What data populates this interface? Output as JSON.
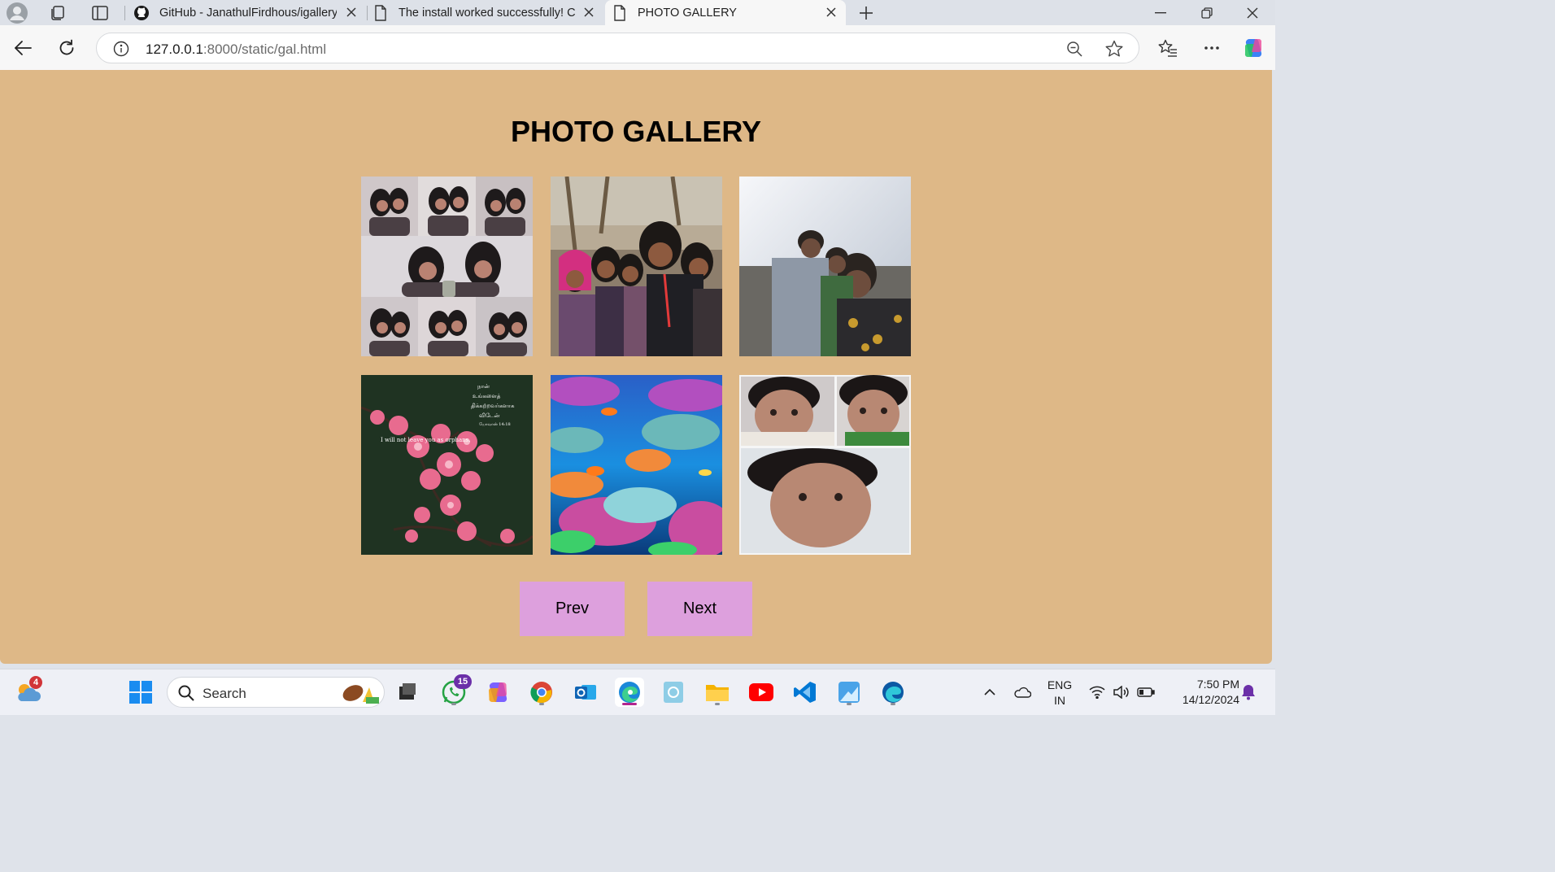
{
  "browser": {
    "tabs": [
      {
        "title": "GitHub - JanathulFirdhous/igallery",
        "icon": "github-icon",
        "active": false
      },
      {
        "title": "The install worked successfully! Congratulations!",
        "icon": "page-icon",
        "active": false
      },
      {
        "title": "PHOTO GALLERY",
        "icon": "page-icon",
        "active": true
      }
    ],
    "address": {
      "host": "127.0.0.1",
      "path": ":8000/static/gal.html"
    }
  },
  "page": {
    "heading": "PHOTO GALLERY",
    "background_color": "#deb887",
    "photos": [
      {
        "subject": "selfie-collage",
        "caption": ""
      },
      {
        "subject": "group-selfie-outdoors",
        "caption": ""
      },
      {
        "subject": "family-selfie-beach",
        "caption": ""
      },
      {
        "subject": "cherry-blossom-verse",
        "caption": "I will not leave you as orphans."
      },
      {
        "subject": "coral-reef",
        "caption": ""
      },
      {
        "subject": "baby-collage",
        "caption": ""
      }
    ],
    "buttons": {
      "prev": "Prev",
      "next": "Next"
    },
    "button_color": "#dda0dd"
  },
  "taskbar": {
    "search_label": "Search",
    "weather_badge": "4",
    "whatsapp_badge": "15",
    "apps": [
      "start-icon",
      "file-explorer-taskview-icon",
      "whatsapp-icon",
      "copilot-icon",
      "chrome-icon",
      "outlook-icon",
      "edge-icon",
      "photos-icon",
      "folder-icon",
      "youtube-icon",
      "vscode-icon",
      "paint-icon",
      "edge-dev-icon"
    ],
    "language": {
      "line1": "ENG",
      "line2": "IN"
    },
    "clock": {
      "time": "7:50 PM",
      "date": "14/12/2024"
    }
  }
}
